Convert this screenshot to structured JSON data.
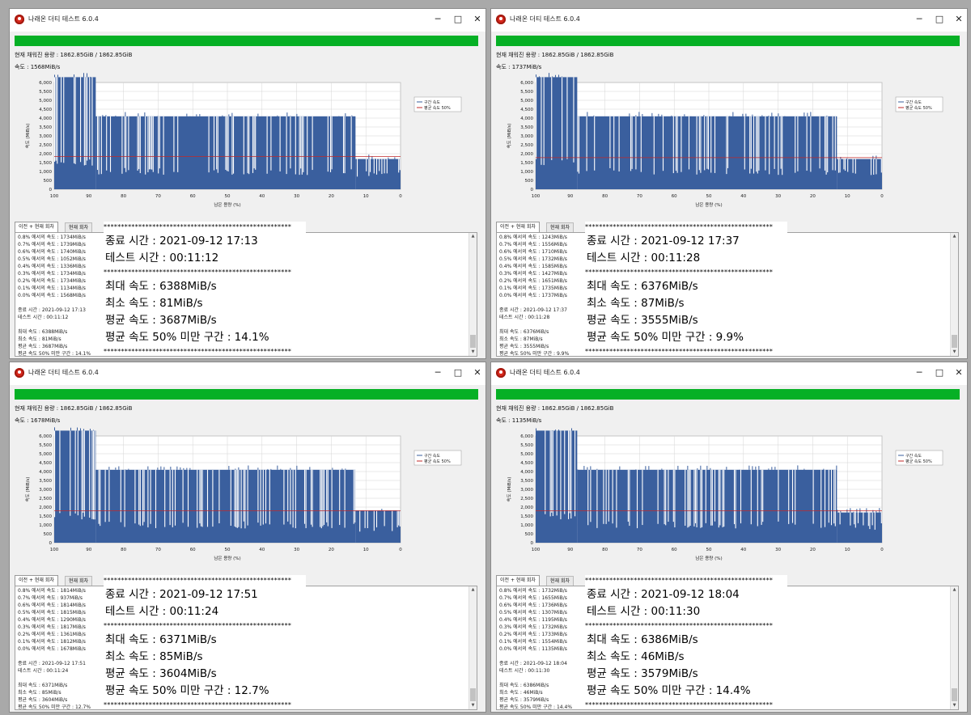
{
  "colors": {
    "progress": "#06b025",
    "bars": "#3a5f9e",
    "avg_line": "#c0282a",
    "background": "#f0f0f0"
  },
  "app_icon": "red-circle-app-icon",
  "window_buttons": {
    "minimize": "─",
    "maximize": "□",
    "close": "✕"
  },
  "stars": "******************************************************",
  "windows": [
    {
      "title": "나래온 더티 테스트 6.0.4",
      "capacity": "현재 채워진 용량 : 1862.85GiB / 1862.85GiB",
      "speed": "속도 : 1568MiB/s",
      "tabs": [
        "이전 + 현재 회차",
        "현재 회차"
      ],
      "log": [
        "0.8% 에서의 속도 : 1734MiB/s",
        "0.7% 에서의 속도 : 1739MiB/s",
        "0.6% 에서의 속도 : 1740MiB/s",
        "0.5% 에서의 속도 : 1052MiB/s",
        "0.4% 에서의 속도 : 1336MiB/s",
        "0.3% 에서의 속도 : 1734MiB/s",
        "0.2% 에서의 속도 : 1734MiB/s",
        "0.1% 에서의 속도 : 1134MiB/s",
        "0.0% 에서의 속도 : 1568MiB/s",
        "",
        "종료 시간 : 2021-09-12 17:13",
        "테스트 시간 : 00:11:12",
        "",
        "최대 속도 : 6388MiB/s",
        "최소 속도 : 81MiB/s",
        "평균 속도 : 3687MiB/s",
        "평균 속도 50% 미만 구간 : 14.1%",
        "******************************"
      ],
      "overlay": {
        "end_time": "종료 시간 : 2021-09-12 17:13",
        "test_time": "테스트 시간 : 00:11:12",
        "max": "최대 속도 : 6388MiB/s",
        "min": "최소 속도 : 81MiB/s",
        "avg": "평균 속도 : 3687MiB/s",
        "below50": "평균 속도 50% 미만 구간 : 14.1%"
      }
    },
    {
      "title": "나래온 더티 테스트 6.0.4",
      "capacity": "현재 채워진 용량 : 1862.85GiB / 1862.85GiB",
      "speed": "속도 : 1737MiB/s",
      "tabs": [
        "이전 + 현재 회차",
        "현재 회차"
      ],
      "log": [
        "0.8% 에서의 속도 : 1243MiB/s",
        "0.7% 에서의 속도 : 1556MiB/s",
        "0.6% 에서의 속도 : 1710MiB/s",
        "0.5% 에서의 속도 : 1732MiB/s",
        "0.4% 에서의 속도 : 1585MiB/s",
        "0.3% 에서의 속도 : 1427MiB/s",
        "0.2% 에서의 속도 : 1651MiB/s",
        "0.1% 에서의 속도 : 1735MiB/s",
        "0.0% 에서의 속도 : 1737MiB/s",
        "",
        "종료 시간 : 2021-09-12 17:37",
        "테스트 시간 : 00:11:28",
        "",
        "최대 속도 : 6376MiB/s",
        "최소 속도 : 87MiB/s",
        "평균 속도 : 3555MiB/s",
        "평균 속도 50% 미만 구간 : 9.9%",
        "******************************"
      ],
      "overlay": {
        "end_time": "종료 시간 : 2021-09-12 17:37",
        "test_time": "테스트 시간 : 00:11:28",
        "max": "최대 속도 : 6376MiB/s",
        "min": "최소 속도 : 87MiB/s",
        "avg": "평균 속도 : 3555MiB/s",
        "below50": "평균 속도 50% 미만 구간 : 9.9%"
      }
    },
    {
      "title": "나래온 더티 테스트 6.0.4",
      "capacity": "현재 채워진 용량 : 1862.85GiB / 1862.85GiB",
      "speed": "속도 : 1678MiB/s",
      "tabs": [
        "이전 + 현재 회차",
        "현재 회차"
      ],
      "log": [
        "0.8% 에서의 속도 : 1814MiB/s",
        "0.7% 에서의 속도 : 937MiB/s",
        "0.6% 에서의 속도 : 1814MiB/s",
        "0.5% 에서의 속도 : 1815MiB/s",
        "0.4% 에서의 속도 : 1290MiB/s",
        "0.3% 에서의 속도 : 1817MiB/s",
        "0.2% 에서의 속도 : 1361MiB/s",
        "0.1% 에서의 속도 : 1812MiB/s",
        "0.0% 에서의 속도 : 1678MiB/s",
        "",
        "종료 시간 : 2021-09-12 17:51",
        "테스트 시간 : 00:11:24",
        "",
        "최대 속도 : 6371MiB/s",
        "최소 속도 : 85MiB/s",
        "평균 속도 : 3604MiB/s",
        "평균 속도 50% 미만 구간 : 12.7%",
        "******************************"
      ],
      "overlay": {
        "end_time": "종료 시간 : 2021-09-12 17:51",
        "test_time": "테스트 시간 : 00:11:24",
        "max": "최대 속도 : 6371MiB/s",
        "min": "최소 속도 : 85MiB/s",
        "avg": "평균 속도 : 3604MiB/s",
        "below50": "평균 속도 50% 미만 구간 : 12.7%"
      }
    },
    {
      "title": "나래온 더티 테스트 6.0.4",
      "capacity": "현재 채워진 용량 : 1862.85GiB / 1862.85GiB",
      "speed": "속도 : 1135MiB/s",
      "tabs": [
        "이전 + 현재 회차",
        "현재 회차"
      ],
      "log": [
        "0.8% 에서의 속도 : 1732MiB/s",
        "0.7% 에서의 속도 : 1655MiB/s",
        "0.6% 에서의 속도 : 1736MiB/s",
        "0.5% 에서의 속도 : 1307MiB/s",
        "0.4% 에서의 속도 : 1195MiB/s",
        "0.3% 에서의 속도 : 1732MiB/s",
        "0.2% 에서의 속도 : 1733MiB/s",
        "0.1% 에서의 속도 : 1554MiB/s",
        "0.0% 에서의 속도 : 1135MiB/s",
        "",
        "종료 시간 : 2021-09-12 18:04",
        "테스트 시간 : 00:11:30",
        "",
        "최대 속도 : 6386MiB/s",
        "최소 속도 : 46MiB/s",
        "평균 속도 : 3579MiB/s",
        "평균 속도 50% 미만 구간 : 14.4%",
        "******************************"
      ],
      "overlay": {
        "end_time": "종료 시간 : 2021-09-12 18:04",
        "test_time": "테스트 시간 : 00:11:30",
        "max": "최대 속도 : 6386MiB/s",
        "min": "최소 속도 : 46MiB/s",
        "avg": "평균 속도 : 3579MiB/s",
        "below50": "평균 속도 50% 미만 구간 : 14.4%"
      }
    }
  ],
  "chart_data": [
    {
      "type": "area",
      "xlabel": "남은 용량 (%)",
      "ylabel": "속도 (MiB/s)",
      "xlim": [
        100,
        0
      ],
      "ylim": [
        0,
        6000
      ],
      "x_ticks": [
        100,
        90,
        80,
        70,
        60,
        50,
        40,
        30,
        20,
        10,
        0
      ],
      "y_ticks": [
        "0",
        "500",
        "1,000",
        "1,500",
        "2,000",
        "2,500",
        "3,000",
        "3,500",
        "4,000",
        "4,500",
        "5,000",
        "5,500",
        "6,000"
      ],
      "grid": true,
      "legend_position": "top-right",
      "series": [
        {
          "name": "구간 속도",
          "segments": [
            {
              "from": 100,
              "to": 88,
              "mid": 6300,
              "low": 1300
            },
            {
              "from": 88,
              "to": 13,
              "mid": 4100,
              "low": 800
            },
            {
              "from": 13,
              "to": 0,
              "mid": 1700,
              "low": 700
            }
          ]
        },
        {
          "name": "평균 속도 50%",
          "value": 1840
        }
      ]
    },
    {
      "type": "area",
      "xlabel": "남은 용량 (%)",
      "ylabel": "속도 (MiB/s)",
      "xlim": [
        100,
        0
      ],
      "ylim": [
        0,
        6000
      ],
      "x_ticks": [
        100,
        90,
        80,
        70,
        60,
        50,
        40,
        30,
        20,
        10,
        0
      ],
      "y_ticks": [
        "0",
        "500",
        "1,000",
        "1,500",
        "2,000",
        "2,500",
        "3,000",
        "3,500",
        "4,000",
        "4,500",
        "5,000",
        "5,500",
        "6,000"
      ],
      "grid": true,
      "legend_position": "top-right",
      "series": [
        {
          "name": "구간 속도",
          "segments": [
            {
              "from": 100,
              "to": 88,
              "mid": 6300,
              "low": 1300
            },
            {
              "from": 88,
              "to": 13,
              "mid": 4100,
              "low": 800
            },
            {
              "from": 13,
              "to": 0,
              "mid": 1700,
              "low": 800
            }
          ]
        },
        {
          "name": "평균 속도 50%",
          "value": 1780
        }
      ]
    },
    {
      "type": "area",
      "xlabel": "남은 용량 (%)",
      "ylabel": "속도 (MiB/s)",
      "xlim": [
        100,
        0
      ],
      "ylim": [
        0,
        6000
      ],
      "x_ticks": [
        100,
        90,
        80,
        70,
        60,
        50,
        40,
        30,
        20,
        10,
        0
      ],
      "y_ticks": [
        "0",
        "500",
        "1,000",
        "1,500",
        "2,000",
        "2,500",
        "3,000",
        "3,500",
        "4,000",
        "4,500",
        "5,000",
        "5,500",
        "6,000"
      ],
      "grid": true,
      "legend_position": "top-right",
      "series": [
        {
          "name": "구간 속도",
          "segments": [
            {
              "from": 100,
              "to": 88,
              "mid": 6300,
              "low": 1300
            },
            {
              "from": 88,
              "to": 13,
              "mid": 4100,
              "low": 800
            },
            {
              "from": 13,
              "to": 0,
              "mid": 1800,
              "low": 600
            }
          ]
        },
        {
          "name": "평균 속도 50%",
          "value": 1800
        }
      ]
    },
    {
      "type": "area",
      "xlabel": "남은 용량 (%)",
      "ylabel": "속도 (MiB/s)",
      "xlim": [
        100,
        0
      ],
      "ylim": [
        0,
        6000
      ],
      "x_ticks": [
        100,
        90,
        80,
        70,
        60,
        50,
        40,
        30,
        20,
        10,
        0
      ],
      "y_ticks": [
        "0",
        "500",
        "1,000",
        "1,500",
        "2,000",
        "2,500",
        "3,000",
        "3,500",
        "4,000",
        "4,500",
        "5,000",
        "5,500",
        "6,000"
      ],
      "grid": true,
      "legend_position": "top-right",
      "series": [
        {
          "name": "구간 속도",
          "segments": [
            {
              "from": 100,
              "to": 88,
              "mid": 6300,
              "low": 1300
            },
            {
              "from": 88,
              "to": 13,
              "mid": 4100,
              "low": 800
            },
            {
              "from": 13,
              "to": 0,
              "mid": 1700,
              "low": 700
            }
          ]
        },
        {
          "name": "평균 속도 50%",
          "value": 1790
        }
      ]
    }
  ]
}
